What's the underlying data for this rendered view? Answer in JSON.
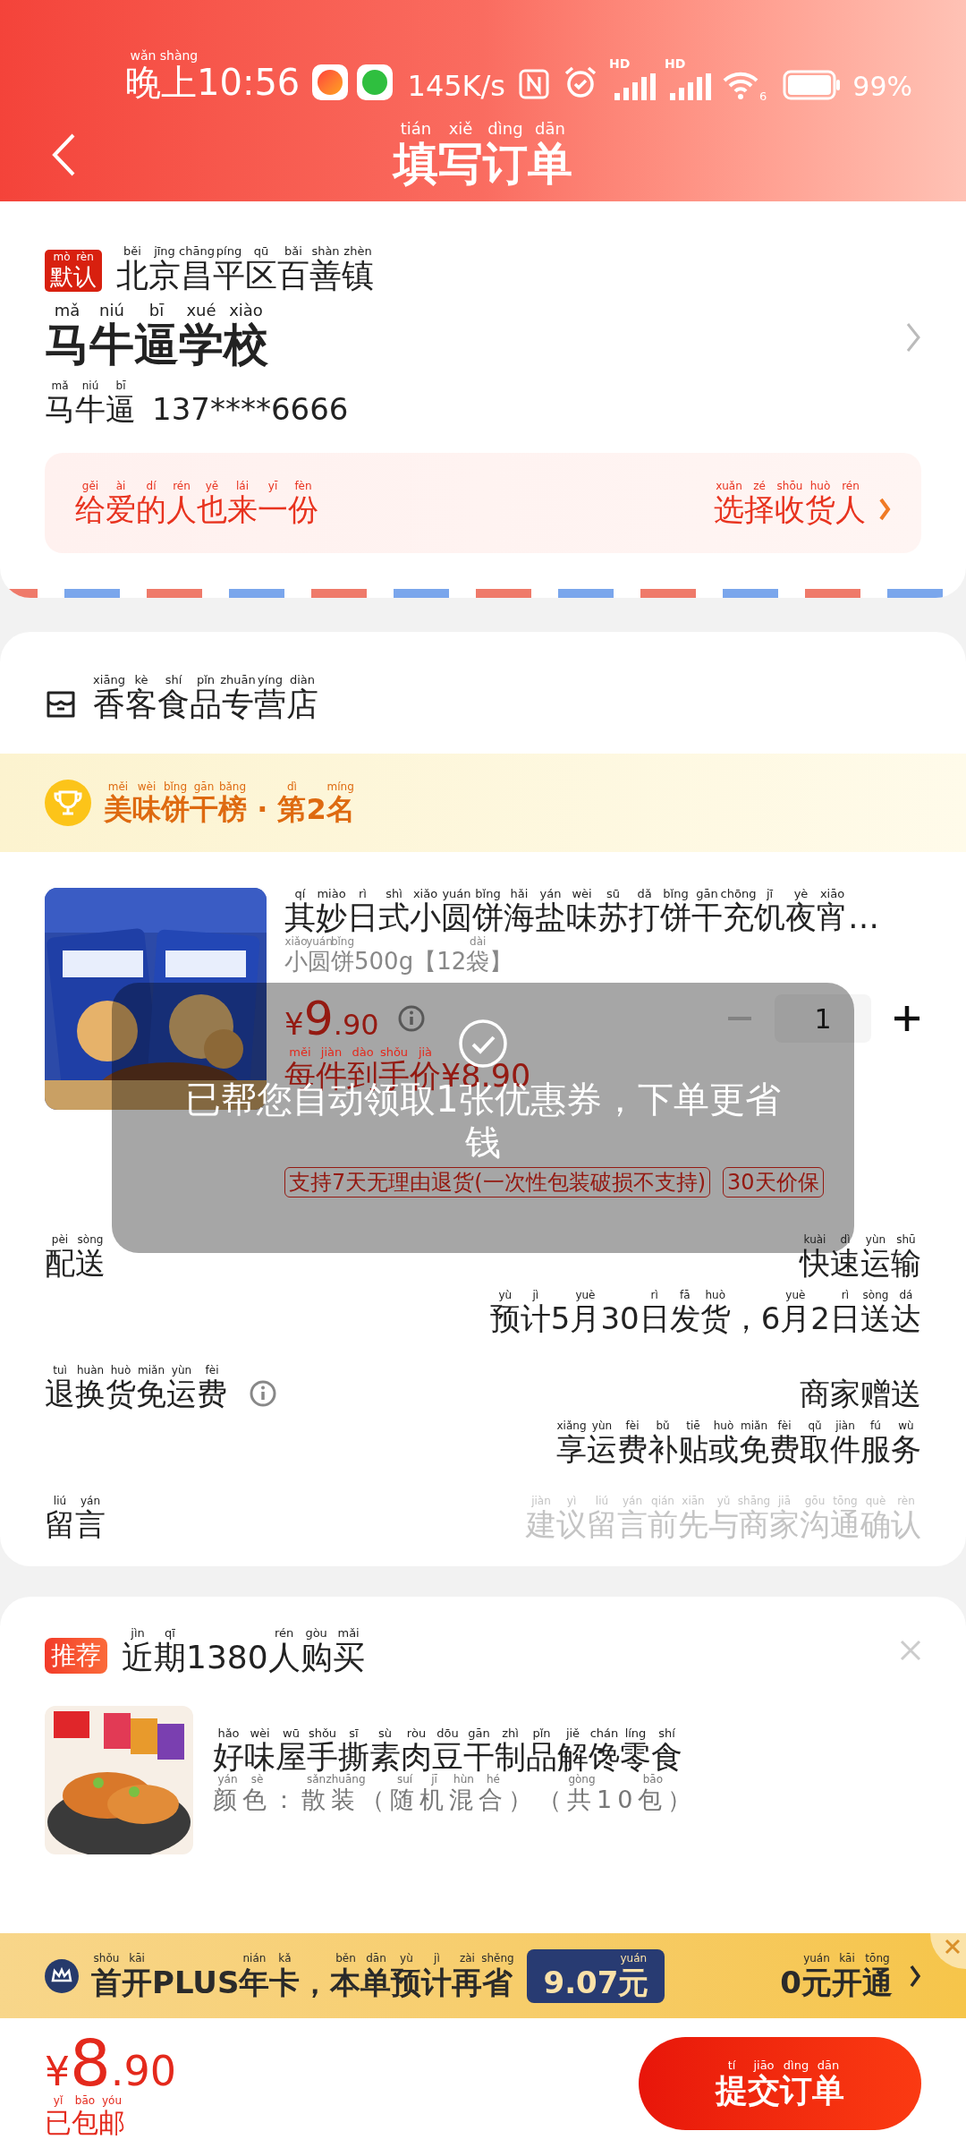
{
  "status_bar": {
    "time": "晚上10:56",
    "time_pinyin": [
      "wǎn",
      "shàng"
    ],
    "speed": "145K/s",
    "signal_labels": [
      "HD",
      "HD"
    ],
    "wifi_label": "6",
    "battery": "99%"
  },
  "header": {
    "title": "填写订单",
    "title_pinyin": [
      "tián",
      "xiě",
      "dìng",
      "dān"
    ]
  },
  "address": {
    "badge": "默认",
    "badge_pinyin": [
      "mò",
      "rèn"
    ],
    "region": "北京昌平区百善镇",
    "region_pinyin": [
      "běi",
      "jīng",
      "chāng",
      "píng",
      "qū",
      "bǎi",
      "shàn",
      "zhèn"
    ],
    "detail": "马牛逼学校",
    "detail_pinyin": [
      "mǎ",
      "niú",
      "bī",
      "xué",
      "xiào"
    ],
    "name": "马牛逼",
    "name_pinyin": [
      "mǎ",
      "niú",
      "bī"
    ],
    "phone": "137****6666",
    "gift_text": "给爱的人也来一份",
    "gift_text_pinyin": [
      "gěi",
      "ài",
      "dí",
      "rén",
      "yě",
      "lái",
      "yī",
      "fèn"
    ],
    "gift_action": "选择收货人",
    "gift_action_pinyin": [
      "xuǎn",
      "zé",
      "shōu",
      "huò",
      "rén"
    ]
  },
  "store": {
    "name": "香客食品专营店",
    "name_pinyin": [
      "xiāng",
      "kè",
      "shí",
      "pǐn",
      "zhuān",
      "yíng",
      "diàn"
    ],
    "ranking": "美味饼干榜 · 第2名",
    "ranking_pinyin": [
      "měi",
      "wèi",
      "bǐng",
      "gān",
      "bǎng",
      "dì",
      "míng"
    ]
  },
  "product": {
    "title": "其妙日式小圆饼海盐味苏打饼干充饥夜宵…",
    "title_pinyin": [
      "qí",
      "miào",
      "rì",
      "shì",
      "xiǎo",
      "yuán",
      "bǐng",
      "hǎi",
      "yán",
      "wèi",
      "sū",
      "dǎ",
      "bǐng",
      "gān",
      "chōng",
      "jī",
      "yè",
      "xiāo"
    ],
    "spec": "小圆饼500g【12袋】",
    "spec_pinyin": [
      "xiǎo",
      "yuán",
      "bǐng",
      "dài"
    ],
    "price_symbol": "¥",
    "price_int": "9",
    "price_dec": ".90",
    "quantity": "1",
    "minus_disabled": true,
    "unit_price": "每件到手价¥8.90",
    "unit_price_pinyin": [
      "měi",
      "jiàn",
      "dào",
      "shǒu",
      "jià"
    ],
    "tags": [
      "支持7天无理由退货(一次性包装破损不支持)",
      "30天价保"
    ]
  },
  "rows": [
    {
      "kind": "text",
      "label": "配送",
      "label_pinyin": [
        "pèi",
        "sòng"
      ],
      "info": false,
      "value": "快速运输",
      "value_pinyin": [
        "kuài",
        "dì",
        "yùn",
        "shū"
      ],
      "note": "预计5月30日发货，6月2日送达",
      "note_pinyin": [
        "yù",
        "jì",
        "yuè",
        "rì",
        "fā",
        "huò",
        "yuè",
        "rì",
        "sòng",
        "dá"
      ]
    },
    {
      "kind": "text",
      "label": "退换货免运费",
      "label_pinyin": [
        "tuì",
        "huàn",
        "huò",
        "miǎn",
        "yùn",
        "fèi"
      ],
      "info": true,
      "value": "商家赠送",
      "note": "享运费补贴或免费取件服务",
      "note_pinyin": [
        "xiǎng",
        "yùn",
        "fèi",
        "bǔ",
        "tiē",
        "huò",
        "miǎn",
        "fèi",
        "qǔ",
        "jiàn",
        "fú",
        "wù"
      ]
    },
    {
      "kind": "input",
      "label": "留言",
      "label_pinyin": [
        "liú",
        "yán"
      ],
      "info": false,
      "placeholder": "建议留言前先与商家沟通确认",
      "placeholder_pinyin": [
        "jiàn",
        "yì",
        "liú",
        "yán",
        "qián",
        "xiān",
        "yǔ",
        "shāng",
        "jiā",
        "gōu",
        "tōng",
        "què",
        "rèn"
      ]
    }
  ],
  "recommend": {
    "badge": "推荐",
    "title": "近期1380人购买",
    "title_pinyin": [
      "jìn",
      "qī",
      "rén",
      "gòu",
      "mǎi"
    ],
    "item_title": "好味屋手撕素肉豆干制品解馋零食",
    "item_title_pinyin": [
      "hǎo",
      "wèi",
      "wū",
      "shǒu",
      "sī",
      "sù",
      "ròu",
      "dōu",
      "gān",
      "zhì",
      "pǐn",
      "jiě",
      "chán",
      "líng",
      "shí"
    ],
    "item_spec": "颜色：散装（随机混合）（共10包）",
    "item_spec_pinyin": [
      "yán",
      "sè",
      "sǎn",
      "zhuāng",
      "suí",
      "jī",
      "hùn",
      "hé",
      "gòng",
      "bāo"
    ]
  },
  "plus_banner": {
    "text": "首开PLUS年卡，本单预计再省",
    "text_pinyin": [
      "shǒu",
      "kāi",
      "nián",
      "kǎ",
      "běn",
      "dān",
      "yù",
      "jì",
      "zài",
      "shěng"
    ],
    "amount": "9.07元",
    "amount_pinyin": [
      "yuán"
    ],
    "action": "0元开通",
    "action_pinyin": [
      "yuán",
      "kāi",
      "tōng"
    ]
  },
  "footer": {
    "total_symbol": "¥",
    "total_int": "8",
    "total_dec": ".90",
    "shipping": "已包邮",
    "shipping_pinyin": [
      "yǐ",
      "bāo",
      "yóu"
    ],
    "submit": "提交订单",
    "submit_pinyin": [
      "tí",
      "jiāo",
      "dìng",
      "dān"
    ]
  },
  "toast": {
    "message": "已帮您自动领取1张优惠券，下单更省钱"
  }
}
